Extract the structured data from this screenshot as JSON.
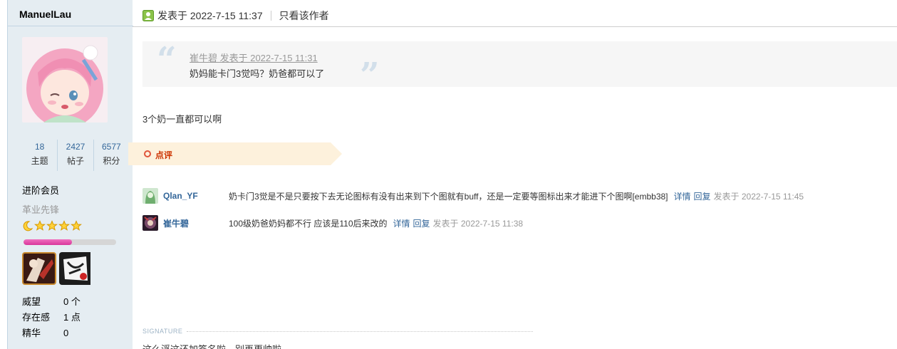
{
  "author": {
    "name": "ManuelLau",
    "stats": [
      {
        "value": "18",
        "label": "主题"
      },
      {
        "value": "2427",
        "label": "帖子"
      },
      {
        "value": "6577",
        "label": "积分"
      }
    ],
    "group": "进阶会员",
    "group_sub": "革业先锋",
    "star_icons": [
      "moon-icon",
      "star-icon",
      "star-icon",
      "star-icon",
      "star-icon"
    ],
    "level_progress_fraction": 0.52,
    "profile": [
      {
        "key": "威望",
        "value": "0 个"
      },
      {
        "key": "存在感",
        "value": "1 点"
      },
      {
        "key": "精华",
        "value": "0"
      }
    ]
  },
  "post": {
    "posted_at": "发表于 2022-7-15 11:37",
    "only_author": "只看该作者",
    "quote": {
      "meta": "崔牛碧 发表于 2022-7-15 11:31",
      "text": "奶妈能卡门3觉吗？奶爸都可以了"
    },
    "body": "3个奶一直都可以啊",
    "comment_tag": "点评",
    "comments": [
      {
        "user": "Qlan_YF",
        "text": "奶卡门3觉是不是只要按下去无论图标有没有出来到下个图就有buff，还是一定要等图标出来才能进下个图啊[embb38]",
        "detail": "详情",
        "reply": "回复",
        "time": "发表于 2022-7-15 11:45"
      },
      {
        "user": "崔牛碧",
        "text": "100级奶爸奶妈都不行 应该是110后来改的",
        "detail": "详情",
        "reply": "回复",
        "time": "发表于 2022-7-15 11:38"
      }
    ],
    "signature_label": "SIGNATURE",
    "signature_text": "这么浮这还加签名啦，别再更帅啦"
  },
  "colors": {
    "sidebar_bg": "#e5edf2",
    "link_blue": "#336699",
    "comment_tag_bg": "#fdf1dc",
    "comment_tag_red": "#cc3300",
    "quote_bg": "#f6f6f6",
    "progress_pink": "#e44fae"
  }
}
